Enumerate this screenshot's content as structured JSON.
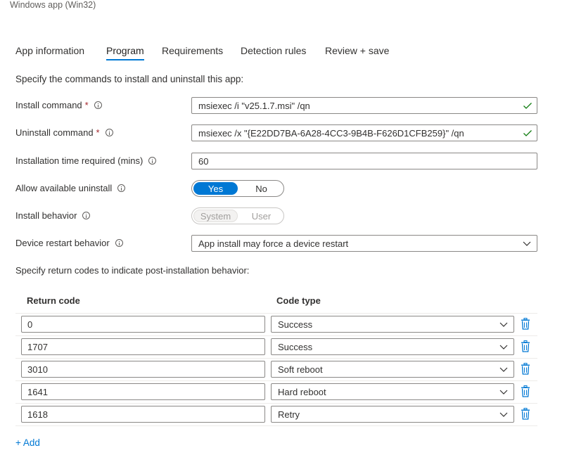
{
  "window_title": "Windows app (Win32)",
  "tabs": [
    {
      "label": "App information"
    },
    {
      "label": "Program"
    },
    {
      "label": "Requirements"
    },
    {
      "label": "Detection rules"
    },
    {
      "label": "Review + save"
    }
  ],
  "active_tab": "Program",
  "intro": "Specify the commands to install and uninstall this app:",
  "form": {
    "install_command": {
      "label": "Install command",
      "required": "*",
      "value": "msiexec /i \"v25.1.7.msi\" /qn"
    },
    "uninstall_command": {
      "label": "Uninstall command",
      "required": "*",
      "value": "msiexec /x \"{E22DD7BA-6A28-4CC3-9B4B-F626D1CFB259}\" /qn"
    },
    "install_time": {
      "label": "Installation time required (mins)",
      "value": "60"
    },
    "allow_uninstall": {
      "label": "Allow available uninstall",
      "options": [
        "Yes",
        "No"
      ],
      "selected": "Yes"
    },
    "install_behavior": {
      "label": "Install behavior",
      "options": [
        "System",
        "User"
      ],
      "selected": "System",
      "disabled": true
    },
    "restart_behavior": {
      "label": "Device restart behavior",
      "value": "App install may force a device restart"
    }
  },
  "return_codes_intro": "Specify return codes to indicate post-installation behavior:",
  "table": {
    "headers": {
      "return_code": "Return code",
      "code_type": "Code type"
    },
    "rows": [
      {
        "code": "0",
        "type": "Success"
      },
      {
        "code": "1707",
        "type": "Success"
      },
      {
        "code": "3010",
        "type": "Soft reboot"
      },
      {
        "code": "1641",
        "type": "Hard reboot"
      },
      {
        "code": "1618",
        "type": "Retry"
      }
    ]
  },
  "add_label": "+ Add",
  "colors": {
    "accent": "#0078d4",
    "valid_check": "#107c10",
    "required": "#a4262c",
    "border": "#8a8886"
  },
  "icons": {
    "info": "info-icon",
    "valid": "checkmark-icon",
    "dropdown": "chevron-down-icon",
    "delete": "trash-icon"
  }
}
